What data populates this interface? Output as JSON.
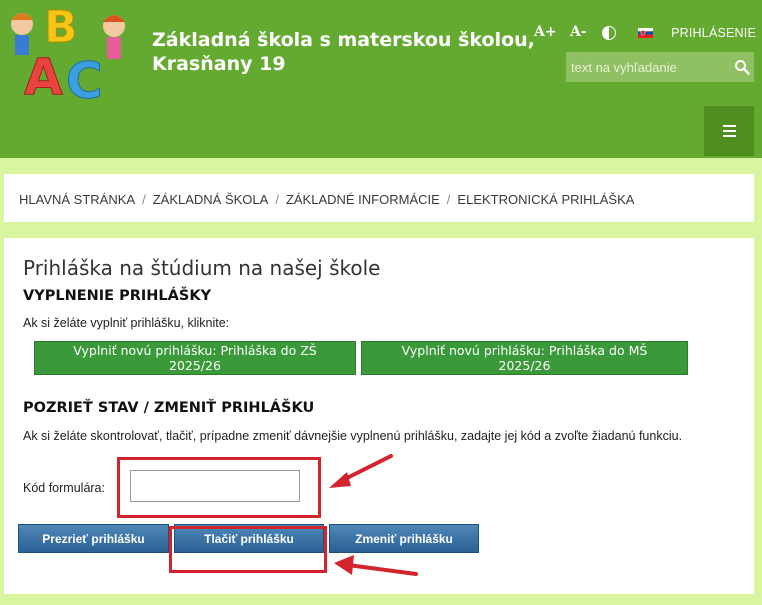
{
  "header": {
    "title_line1": "Základná škola s materskou školou,",
    "title_line2": "Krasňany 19",
    "tools": {
      "font_increase": "A+",
      "font_decrease": "A-",
      "login": "PRIHLÁSENIE"
    },
    "search": {
      "placeholder": "text na vyhľadanie"
    }
  },
  "breadcrumb": [
    "HLAVNÁ STRÁNKA",
    "ZÁKLADNÁ ŠKOLA",
    "ZÁKLADNÉ INFORMÁCIE",
    "ELEKTRONICKÁ PRIHLÁŠKA"
  ],
  "main": {
    "title": "Prihláška na štúdium na našej škole",
    "fill_section": {
      "heading": "VYPLNENIE PRIHLÁŠKY",
      "text": "Ak si želáte vyplniť prihlášku, kliknite:",
      "buttons": [
        "Vyplniť novú prihlášku: Prihláška do ZŠ 2025/26",
        "Vyplniť novú prihlášku: Prihláška do MŠ 2025/26"
      ]
    },
    "view_section": {
      "heading": "POZRIEŤ STAV / ZMENIŤ PRIHLÁŠKU",
      "text": "Ak si želáte skontrolovať, tlačiť, prípadne zmeniť dávnejšie vyplnenú prihlášku, zadajte jej kód a zvoľte žiadanú funkciu.",
      "code_label": "Kód formulára:",
      "code_value": "",
      "buttons": [
        "Prezrieť prihlášku",
        "Tlačiť prihlášku",
        "Zmeniť prihlášku"
      ]
    }
  },
  "colors": {
    "header_green": "#64a930",
    "page_bg": "#d9f5a0",
    "annotation_red": "#d3242d",
    "button_green": "#3a9a3a",
    "button_blue": "#2a6296"
  }
}
